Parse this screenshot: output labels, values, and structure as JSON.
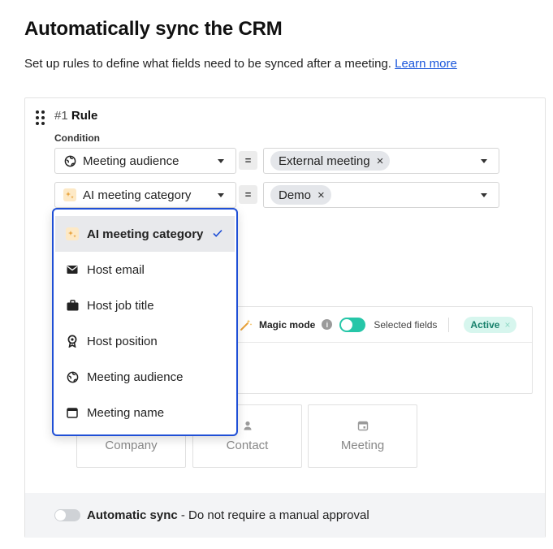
{
  "page": {
    "title": "Automatically sync the CRM",
    "subtitle": "Set up rules to define what fields need to be synced after a meeting.",
    "learn_more": "Learn more"
  },
  "rule": {
    "number": "#1",
    "label": "Rule",
    "condition_label": "Condition",
    "conditions": [
      {
        "field": "Meeting audience",
        "operator": "=",
        "value_chip": "External meeting",
        "field_icon": "globe-icon"
      },
      {
        "field": "AI meeting category",
        "operator": "=",
        "value_chip": "Demo",
        "field_icon": "sparkle-icon"
      }
    ]
  },
  "dropdown": {
    "items": [
      {
        "label": "AI meeting category",
        "icon": "sparkle-icon",
        "selected": true
      },
      {
        "label": "Host email",
        "icon": "envelope-icon",
        "selected": false
      },
      {
        "label": "Host job title",
        "icon": "briefcase-icon",
        "selected": false
      },
      {
        "label": "Host position",
        "icon": "badge-icon",
        "selected": false
      },
      {
        "label": "Meeting audience",
        "icon": "globe-icon",
        "selected": false
      },
      {
        "label": "Meeting name",
        "icon": "calendar-icon",
        "selected": false
      }
    ]
  },
  "fields": {
    "magic_mode_label": "Magic mode",
    "info": "i",
    "selected_fields_label": "Selected fields",
    "active_badge": "Active",
    "remove_glyph": "×"
  },
  "objects": [
    {
      "label": "Company",
      "icon": "building-icon"
    },
    {
      "label": "Contact",
      "icon": "person-icon"
    },
    {
      "label": "Meeting",
      "icon": "calendar-icon"
    }
  ],
  "footer": {
    "auto_sync_label": "Automatic sync",
    "auto_sync_desc": " - Do not require a manual approval",
    "auto_sync_enabled": false
  },
  "colors": {
    "accent": "#1f4fd6",
    "link": "#1a56db",
    "toggle_on": "#26c6a8",
    "active_badge_bg": "#d7f6ee",
    "active_badge_text": "#16806a"
  }
}
